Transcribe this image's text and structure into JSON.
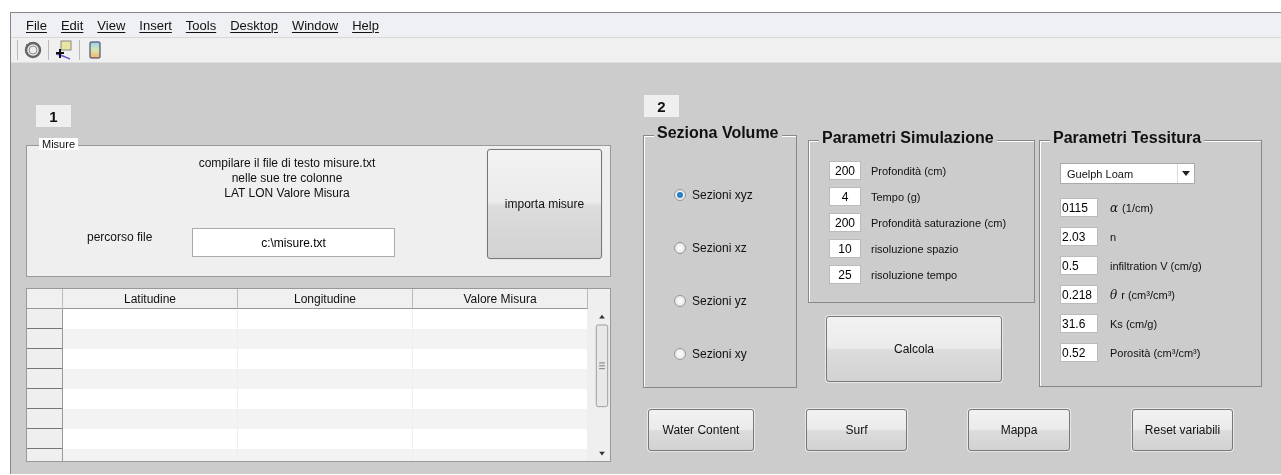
{
  "menu": [
    "File",
    "Edit",
    "View",
    "Insert",
    "Tools",
    "Desktop",
    "Window",
    "Help"
  ],
  "toolbar": [
    {
      "kind": "rotate"
    },
    {
      "kind": "insert"
    },
    {
      "kind": "colorbar"
    }
  ],
  "step_1": {
    "badge": "1",
    "misure_panel": {
      "title": "Misure",
      "instructions": [
        "compilare il file di testo misure.txt",
        "nelle sue tre colonne",
        "LAT LON Valore Misura"
      ],
      "path_label": "percorso file",
      "path_value": "c:\\misure.txt",
      "button": "importa misure"
    },
    "table": {
      "columns": [
        "Latitudine",
        "Longitudine",
        "Valore Misura"
      ]
    }
  },
  "step_2": {
    "badge": "2",
    "seziona_volume": {
      "title": "Seziona Volume",
      "options": [
        {
          "label": "Sezioni xyz",
          "selected": true
        },
        {
          "label": "Sezioni xz",
          "selected": false
        },
        {
          "label": "Sezioni yz",
          "selected": false
        },
        {
          "label": "Sezioni xy",
          "selected": false
        }
      ]
    },
    "parametri_simulazione": {
      "title": "Parametri Simulazione",
      "fields": [
        {
          "value": "200",
          "label": "Profondità (cm)"
        },
        {
          "value": "4",
          "label": "Tempo (g)"
        },
        {
          "value": "200",
          "label": "Profondità saturazione (cm)"
        },
        {
          "value": "10",
          "label": "risoluzione spazio"
        },
        {
          "value": "25",
          "label": "risoluzione tempo"
        }
      ]
    },
    "calcola_button": "Calcola",
    "parametri_tessitura": {
      "title": "Parametri Tessitura",
      "soil_type": "Guelph Loam",
      "fields": [
        {
          "value": "0115",
          "symbol": "α",
          "label": "(1/cm)"
        },
        {
          "value": "2.03",
          "label": "n"
        },
        {
          "value": "0.5",
          "label": "infiltration V (cm/g)"
        },
        {
          "value": "0.218",
          "symbol": "θ",
          "label": "r (cm³/cm³)"
        },
        {
          "value": "31.6",
          "label": "Ks (cm/g)"
        },
        {
          "value": "0.52",
          "label": "Porosità (cm³/cm³)"
        }
      ]
    },
    "buttons": [
      "Water Content",
      "Surf",
      "Mappa",
      "Reset variabili"
    ]
  }
}
